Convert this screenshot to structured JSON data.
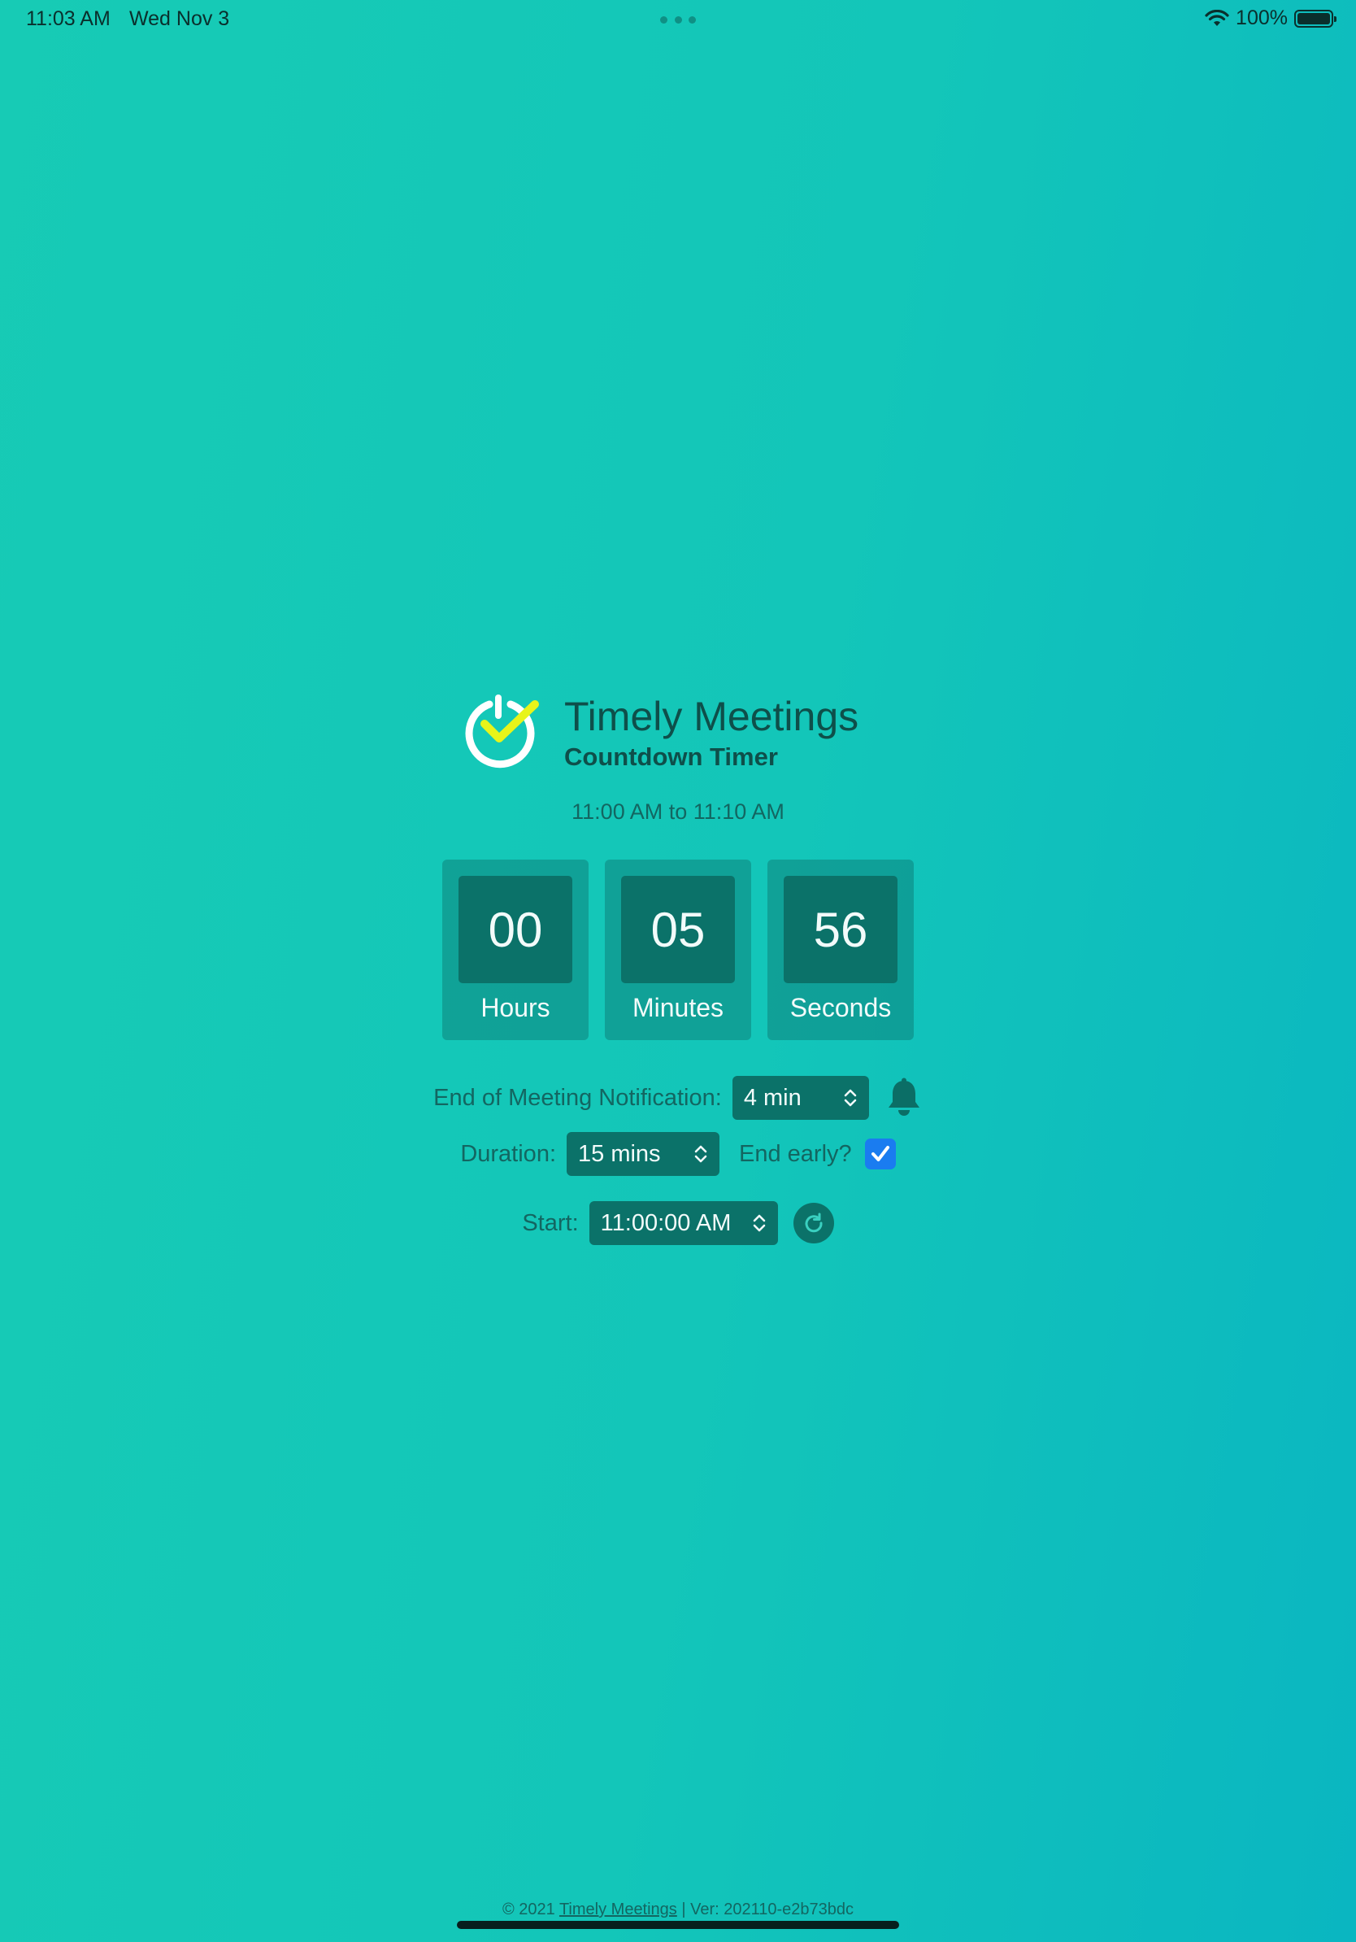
{
  "status_bar": {
    "time": "11:03 AM",
    "date": "Wed Nov 3",
    "battery": "100%"
  },
  "header": {
    "title": "Timely Meetings",
    "subtitle": "Countdown Timer",
    "time_range": "11:00 AM to 11:10 AM"
  },
  "countdown": {
    "hours": {
      "value": "00",
      "label": "Hours"
    },
    "minutes": {
      "value": "05",
      "label": "Minutes"
    },
    "seconds": {
      "value": "56",
      "label": "Seconds"
    }
  },
  "controls": {
    "notification_label": "End of Meeting Notification:",
    "notification_value": "4 min",
    "duration_label": "Duration:",
    "duration_value": "15 mins",
    "end_early_label": "End early?",
    "end_early_checked": true,
    "start_label": "Start:",
    "start_value": "11:00:00 AM"
  },
  "footer": {
    "copyright": "© 2021",
    "link": "Timely Meetings",
    "version": "| Ver: 202110-e2b73bdc"
  },
  "colors": {
    "background": "#13c6b9",
    "tile": "#0b7269",
    "text_dark": "#0e4f4a",
    "checkbox": "#1a7cf0",
    "logo_check": "#e8f41a"
  }
}
